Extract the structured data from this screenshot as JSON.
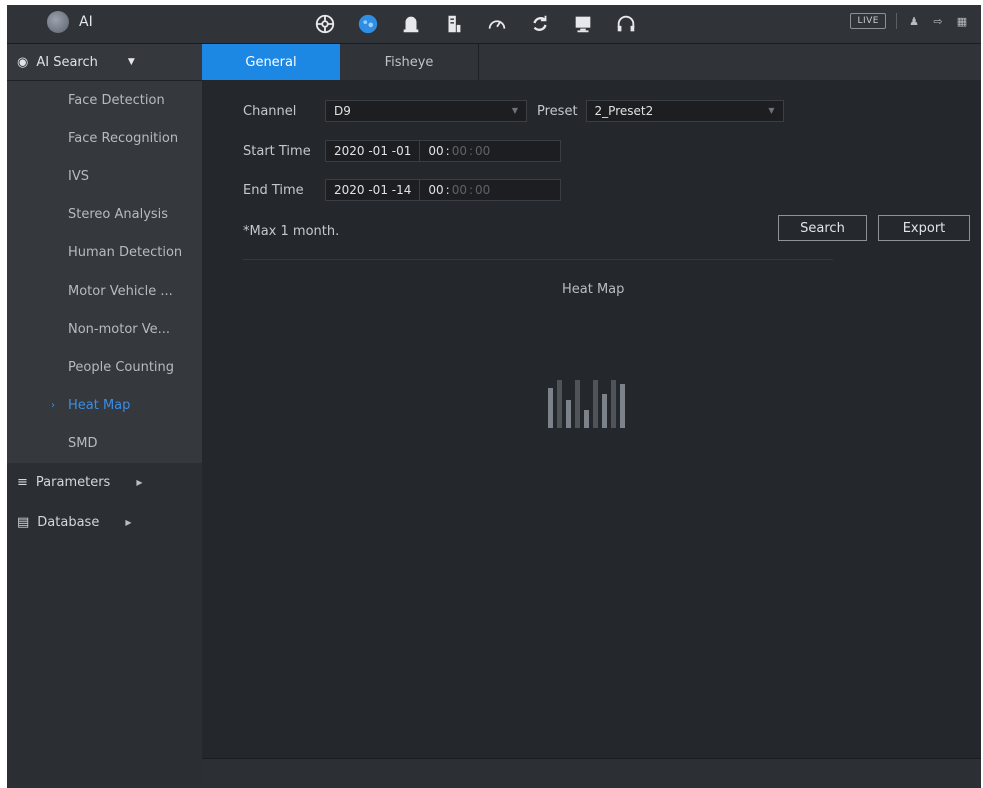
{
  "app": {
    "title": "AI",
    "live_label": "LIVE",
    "top_icons": [
      "search-aperture-icon",
      "ai-brain-icon",
      "alarm-bell-icon",
      "storage-icon",
      "speedometer-icon",
      "refresh-icon",
      "monitor-icon",
      "headset-icon"
    ]
  },
  "sidebar": {
    "header_label": "AI Search",
    "items": [
      {
        "label": "Face Detection"
      },
      {
        "label": "Face Recognition"
      },
      {
        "label": "IVS"
      },
      {
        "label": "Stereo Analysis"
      },
      {
        "label": "Human Detection"
      },
      {
        "label": "Motor Vehicle ..."
      },
      {
        "label": "Non-motor Ve..."
      },
      {
        "label": "People Counting"
      },
      {
        "label": "Heat Map",
        "active": true
      },
      {
        "label": "SMD"
      }
    ],
    "sections": [
      {
        "label": "Parameters"
      },
      {
        "label": "Database"
      }
    ]
  },
  "tabs": [
    {
      "label": "General",
      "active": true
    },
    {
      "label": "Fisheye"
    }
  ],
  "form": {
    "channel_label": "Channel",
    "channel_value": "D9",
    "preset_label": "Preset",
    "preset_value": "2_Preset2",
    "start_label": "Start Time",
    "start_date": "2020 -01 -01",
    "start_hour": "00",
    "start_min": "00",
    "start_sec": "00",
    "end_label": "End Time",
    "end_date": "2020 -01 -14",
    "end_hour": "00",
    "end_min": "00",
    "end_sec": "00",
    "note": "*Max 1 month.",
    "search_label": "Search",
    "export_label": "Export"
  },
  "heatmap": {
    "title": "Heat Map"
  },
  "colors": {
    "accent": "#1d87e4",
    "active_text": "#3a8ee6",
    "background": "#24272b"
  }
}
